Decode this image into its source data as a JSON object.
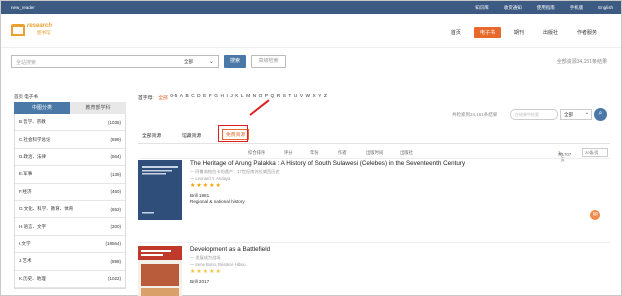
{
  "topbar": {
    "user": "new_reader",
    "links": [
      "知识库",
      "收货通知",
      "使用指南",
      "手机版",
      "English"
    ]
  },
  "header": {
    "logo_name": "research",
    "logo_cn": "图书馆",
    "nav": [
      "首页",
      "电子书",
      "期刊",
      "出版社",
      "作者服务"
    ],
    "nav_active_index": 1
  },
  "search": {
    "placeholder": "全站搜索",
    "scope": "全部",
    "button": "搜索",
    "advanced": "高级检索",
    "total": "全部资源34,151条结果"
  },
  "sidebar": {
    "title": "首页 电子书",
    "tab_active": "中图分类",
    "tab_other": "教育部学科",
    "categories": [
      {
        "name": "B.哲学、宗教",
        "count": "(1035)"
      },
      {
        "name": "C.社会科学总论",
        "count": "(699)"
      },
      {
        "name": "D.政治、法律",
        "count": "(564)"
      },
      {
        "name": "E.军事",
        "count": "(139)"
      },
      {
        "name": "F.经济",
        "count": "(460)"
      },
      {
        "name": "G.文化、科学、教育、体育",
        "count": "(653)"
      },
      {
        "name": "H.语言、文字",
        "count": "(200)"
      },
      {
        "name": "I.文学",
        "count": "(19564)"
      },
      {
        "name": "J.艺术",
        "count": "(898)"
      },
      {
        "name": "K.历史、地理",
        "count": "(1022)"
      }
    ]
  },
  "main": {
    "alpha_label": "首字母:",
    "alpha_all": "全部",
    "alpha_num": "0-5",
    "letters": [
      "A",
      "B",
      "C",
      "D",
      "E",
      "F",
      "G",
      "H",
      "I",
      "J",
      "K",
      "L",
      "M",
      "N",
      "O",
      "P",
      "Q",
      "R",
      "S",
      "T",
      "U",
      "V",
      "W",
      "X",
      "Y",
      "Z"
    ],
    "found": "共检索到34,151条结果",
    "inner_placeholder": "在结果中检索",
    "inner_scope": "全部",
    "res_tabs": [
      "全部资源",
      "馆藏资源",
      "免费资源"
    ],
    "sort_labels": [
      "综合排序",
      "评分",
      "年份",
      "作者",
      "出版时间",
      "出版社"
    ],
    "pager": {
      "prefix": "共",
      "current": "1",
      "suffix": "/1707页"
    },
    "per_page": "20条/页",
    "items": [
      {
        "title": "The Heritage of Arung Palakka : A History of South Sulawesi (Celebes) in the Seventeenth Century",
        "subtitle": "— 阿鲁翁帕拉卡的遗产：17世纪南苏拉威西历史",
        "author": "— Leonard Y. Andaya",
        "stars": "★★★★★",
        "publisher": "Brill 1981",
        "subject": "Regional & national history",
        "cover_color": "#2f4f7a"
      },
      {
        "title": "Development as a Battlefield",
        "subtitle": "— 发展成为战场",
        "author": "— Irene Bono, Béatrice Hibou",
        "stars": "★★★★★",
        "publisher": "Brill 2017",
        "subject": "",
        "cover_color": "#c0392b"
      }
    ]
  },
  "float_icon": "chat-icon"
}
